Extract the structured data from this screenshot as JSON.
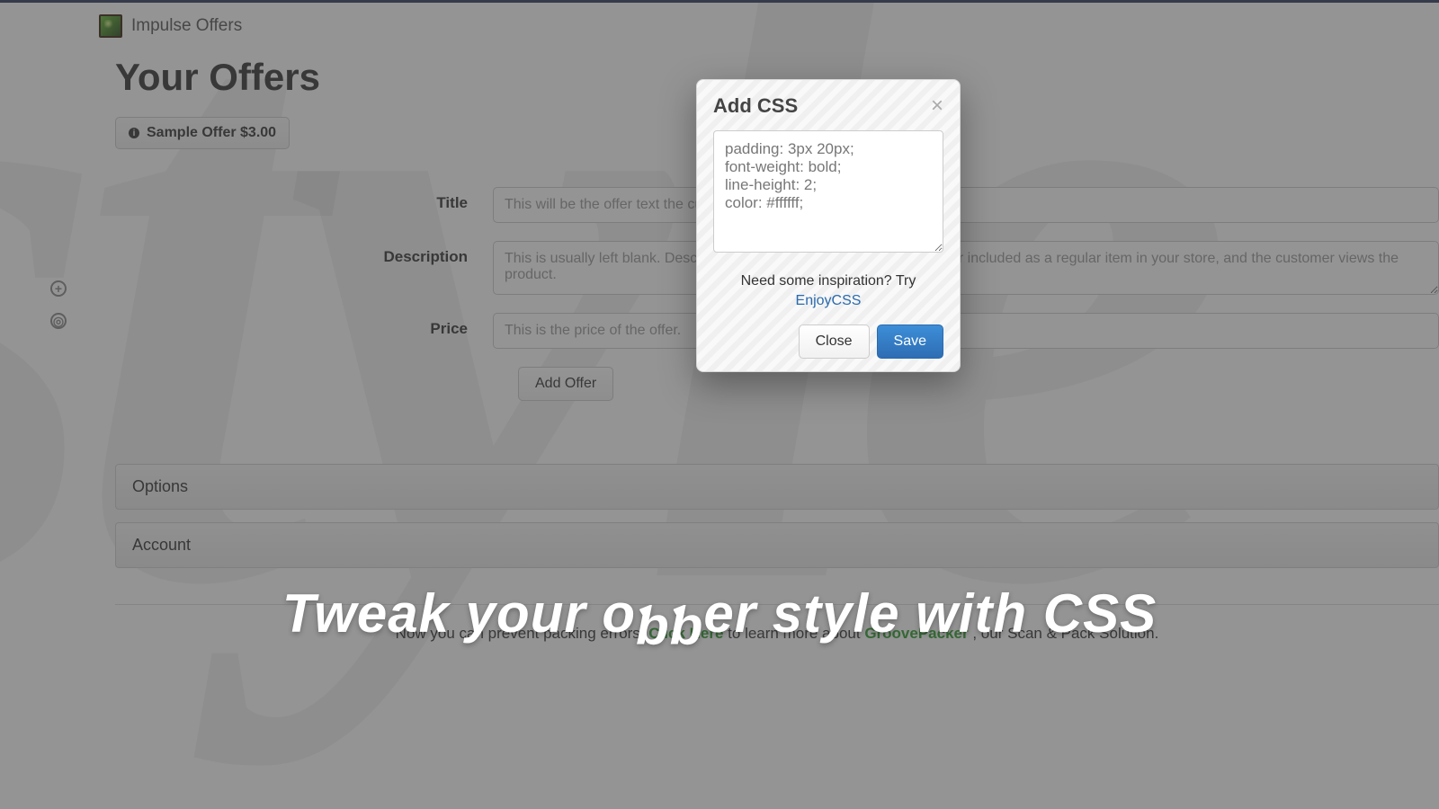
{
  "brand": {
    "name": "Impulse Offers"
  },
  "page": {
    "title": "Your Offers"
  },
  "sample_chip": {
    "label": "Sample Offer $3.00"
  },
  "form": {
    "title_label": "Title",
    "title_placeholder": "This will be the offer text the customer will see on the cart page.",
    "description_label": "Description",
    "description_placeholder": "This is usually left blank. Description is only needed if you have the offer included as a regular item in your store, and the customer views the product.",
    "price_label": "Price",
    "price_placeholder": "This is the price of the offer.",
    "add_offer_label": "Add Offer"
  },
  "accordion": {
    "options_label": "Options",
    "account_label": "Account"
  },
  "footer": {
    "prefix": "Now you can prevent packing errors. ",
    "click_here": "Click Here",
    "middle": " to learn more about ",
    "groove": "GroovePacker",
    "suffix": ", our Scan & Pack Solution."
  },
  "modal": {
    "title": "Add CSS",
    "css_value": "padding: 3px 20px;\nfont-weight: bold;\nline-height: 2;\ncolor: #ffffff;",
    "hint_prefix": "Need some inspiration? Try",
    "hint_link": "EnjoyCSS",
    "close_label": "Close",
    "save_label": "Save"
  },
  "headline": {
    "text_a": "Tweak your o",
    "text_bb": "ƅƅ",
    "text_c": "er style with CSS"
  },
  "left_icons": {
    "plus": "+",
    "eye": "◎"
  }
}
